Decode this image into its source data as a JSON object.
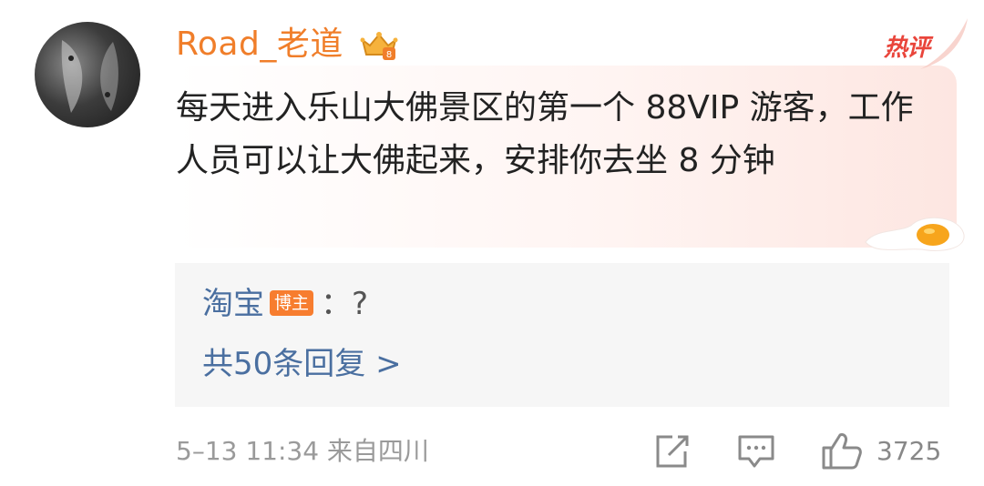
{
  "comment": {
    "username": "Road_老道",
    "hot_label": "热评",
    "text": "每天进入乐山大佛景区的第一个 88VIP 游客，工作人员可以让大佛起来，安排你去坐 8 分钟",
    "reply": {
      "author": "淘宝",
      "badge": "博主",
      "content": "：?",
      "more_replies": "共50条回复 >"
    },
    "meta": "5–13 11:34  来自四川",
    "like_count": "3725"
  },
  "colors": {
    "username": "#f07e2a",
    "hot_tag": "#e9453b",
    "link": "#4a6fa0",
    "badge": "#f77d2f"
  },
  "icons": [
    "vip-crown-icon",
    "share-icon",
    "comment-icon",
    "thumbs-up-icon"
  ]
}
